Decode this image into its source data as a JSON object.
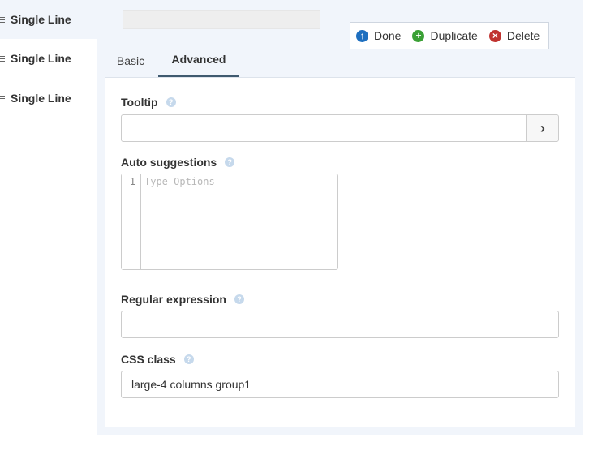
{
  "field_list": {
    "items": [
      {
        "label": "Single Line",
        "active": true
      },
      {
        "label": "Single Line",
        "active": false
      },
      {
        "label": "Single Line",
        "active": false
      }
    ]
  },
  "actions": {
    "done": "Done",
    "duplicate": "Duplicate",
    "delete": "Delete"
  },
  "tabs": {
    "basic": "Basic",
    "advanced": "Advanced",
    "active": "advanced"
  },
  "form": {
    "tooltip": {
      "label": "Tooltip",
      "value": "",
      "help": "?"
    },
    "tooltip_button": "›",
    "auto_suggestions": {
      "label": "Auto suggestions",
      "help": "?",
      "line_number": "1",
      "placeholder": "Type Options"
    },
    "regex": {
      "label": "Regular expression",
      "value": "",
      "help": "?"
    },
    "css_class": {
      "label": "CSS class",
      "value": "large-4 columns group1",
      "help": "?"
    }
  },
  "colors": {
    "panel_bg": "#f1f5fb",
    "tab_active": "#3f5a6f",
    "done": "#1e6fbf",
    "duplicate": "#3aa035",
    "delete": "#c0322f"
  }
}
